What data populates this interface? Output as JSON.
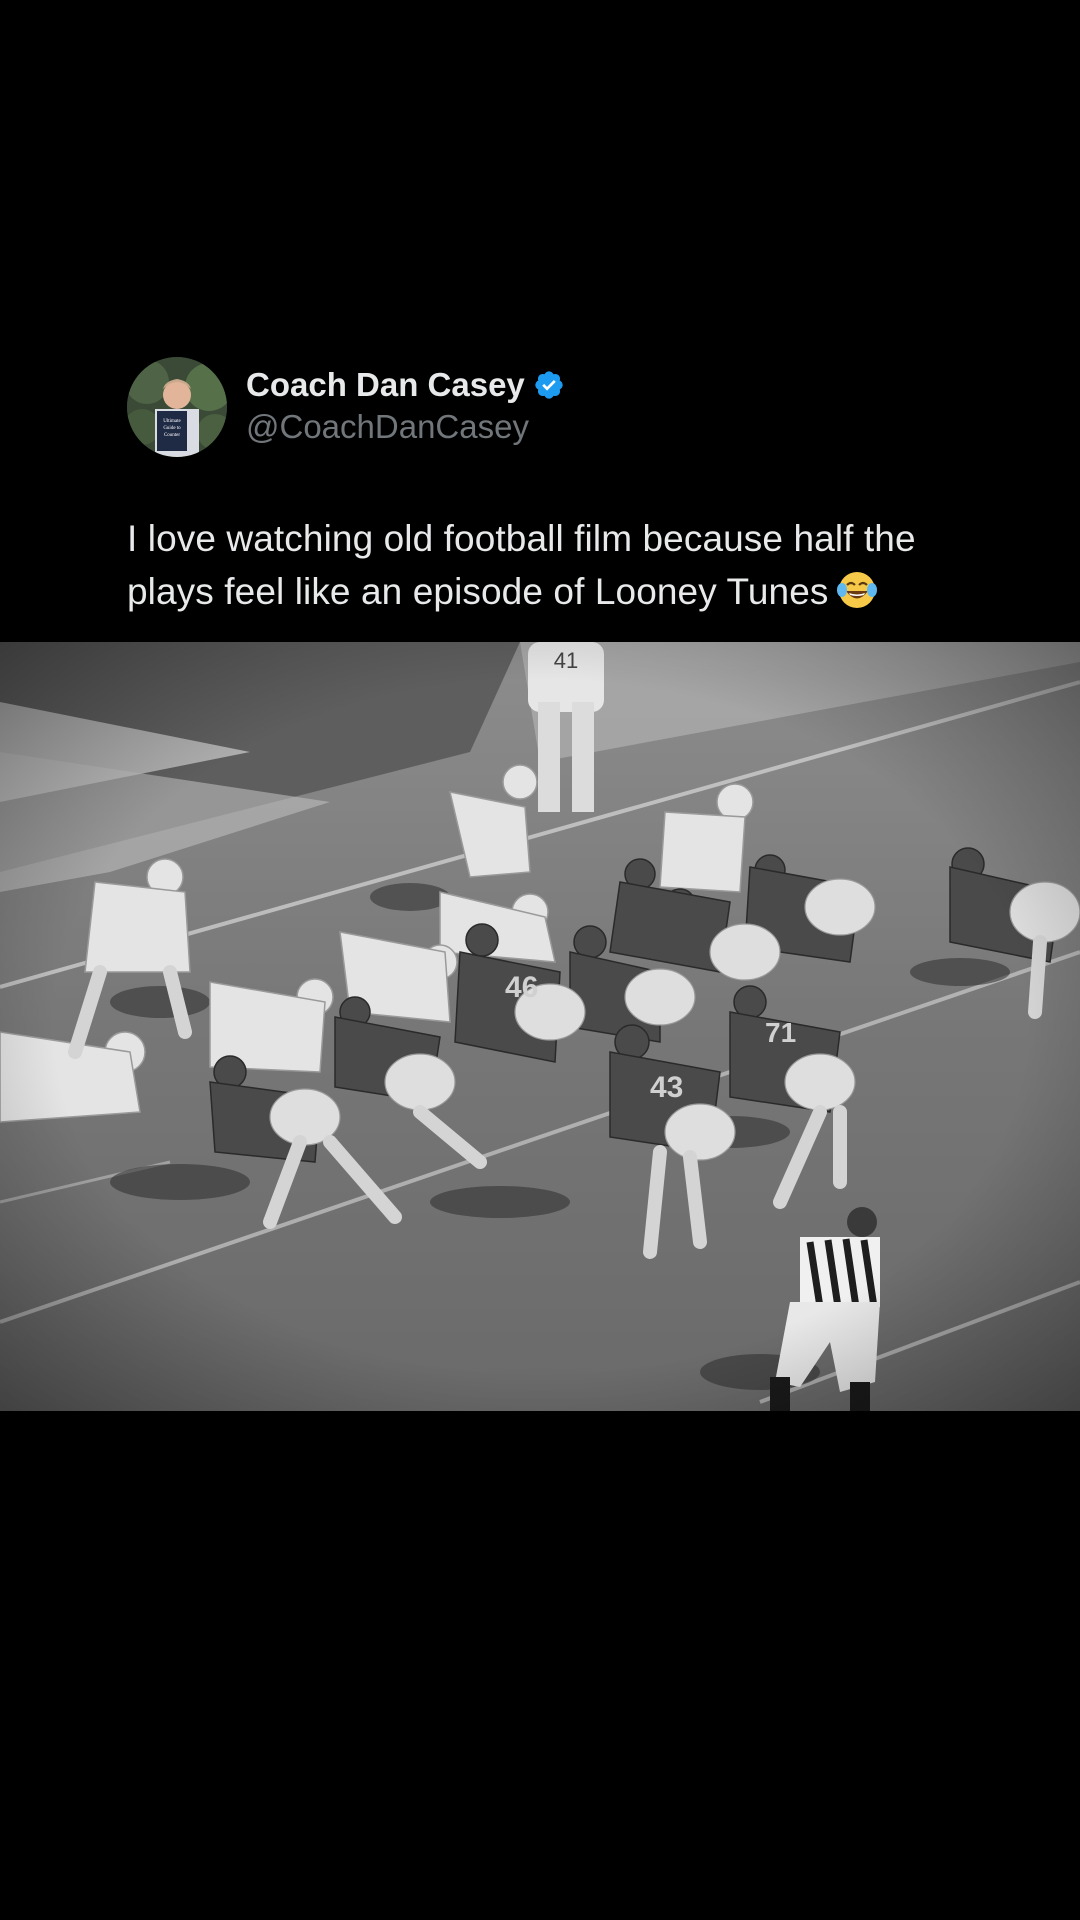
{
  "tweet": {
    "author": {
      "display_name": "Coach Dan Casey",
      "handle": "@CoachDanCasey",
      "verified": true,
      "avatar_icon": "profile-photo-holding-book",
      "avatar_book_text": [
        "Ultimate",
        "Guide to",
        "Counter"
      ]
    },
    "text_line_1": "I love watching old football film because half the",
    "text_line_2": "plays feel like an episode of Looney Tunes",
    "emoji": "face-with-tears-of-joy",
    "media": {
      "type": "image",
      "style": "black-and-white",
      "jersey_numbers": [
        "41",
        "46",
        "43",
        "71"
      ]
    }
  },
  "colors": {
    "background": "#000000",
    "text_primary": "#e7e9ea",
    "text_secondary": "#71767b",
    "verified_badge": "#1d9bf0"
  }
}
